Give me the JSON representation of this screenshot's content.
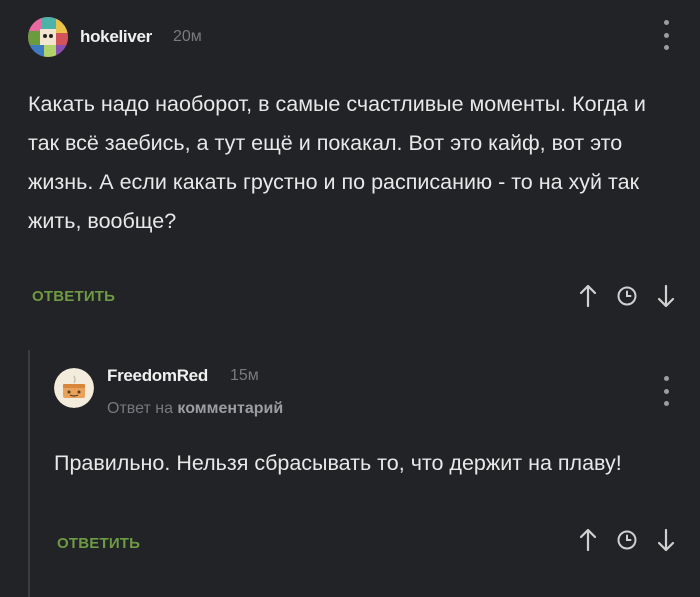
{
  "comments": [
    {
      "username": "hokeliver",
      "time": "20м",
      "text": "Какать надо наоборот, в самые счастливые моменты. Когда и так всё заебись, а тут ещё и покакал. Вот это кайф, вот это жизнь. А если какать грустно и по расписанию - то на хуй так жить, вообще?",
      "reply_label": "ОТВЕТИТЬ",
      "icons": [
        "arrow-up-icon",
        "clock-icon",
        "arrow-down-icon",
        "more-menu-icon"
      ]
    },
    {
      "username": "FreedomRed",
      "time": "15м",
      "reply_prefix": "Ответ на",
      "reply_target": "комментарий",
      "text": "Правильно. Нельзя сбрасывать то, что держит на плаву!",
      "reply_label": "ОТВЕТИТЬ",
      "icons": [
        "arrow-up-icon",
        "clock-icon",
        "arrow-down-icon",
        "more-menu-icon"
      ]
    }
  ],
  "colors": {
    "background": "#222326",
    "text": "#e8e8e8",
    "muted": "#777a7e",
    "reply_green": "#6e9a44"
  }
}
